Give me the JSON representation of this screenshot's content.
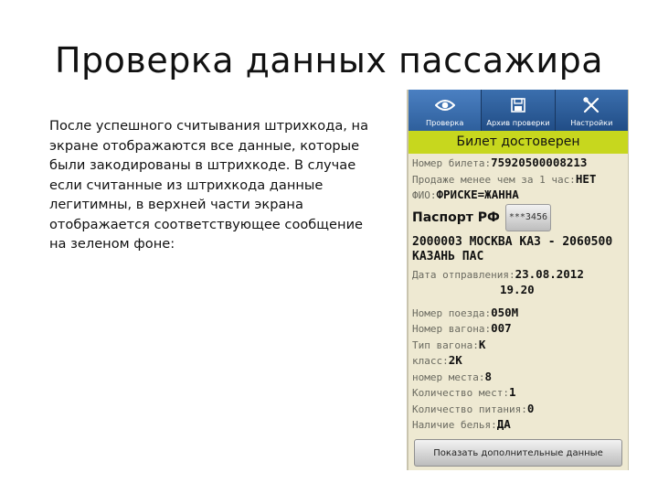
{
  "slide": {
    "title": "Проверка данных пассажира",
    "description": "После успешного считывания штрихкода, на экране отображаются все данные, которые были закодированы в штрихкоде. В случае если считанные из штрихкода данные легитимны, в верхней части экрана отображается соответствующее сообщение на зеленом фоне:"
  },
  "app": {
    "tabs": [
      {
        "label": "Проверка",
        "icon": "eye-icon"
      },
      {
        "label": "Архив проверки",
        "icon": "floppy-disk-icon"
      },
      {
        "label": "Настройки",
        "icon": "tools-icon"
      }
    ],
    "status_banner": "Билет достоверен",
    "status_color": "#c7d71e",
    "ticket_number": {
      "label": "Номер билета:",
      "value": "75920500008213"
    },
    "sold_within_hour": {
      "label": "Продаже менее чем за 1 час:",
      "value": "НЕТ"
    },
    "fio": {
      "label": "ФИО:",
      "value": "ФРИСКЕ=ЖАННА"
    },
    "passport": {
      "label": "Паспорт РФ",
      "button": "***3456"
    },
    "route": "2000003 МОСКВА КАЗ - 2060500 КАЗАНЬ ПАС",
    "departure_date": {
      "label": "Дата отправления:",
      "value": "23.08.2012",
      "time": "19.20"
    },
    "fields": [
      {
        "label": "Номер поезда:",
        "value": "050М"
      },
      {
        "label": "Номер вагона:",
        "value": "007"
      },
      {
        "label": "Тип вагона:",
        "value": "К"
      },
      {
        "label": "класс:",
        "value": "2К"
      },
      {
        "label": "номер места:",
        "value": "8"
      },
      {
        "label": "Количество мест:",
        "value": "1"
      },
      {
        "label": "Количество питания:",
        "value": "0"
      },
      {
        "label": "Наличие белья:",
        "value": "ДА"
      }
    ],
    "show_more_button": "Показать дополнительные данные"
  }
}
